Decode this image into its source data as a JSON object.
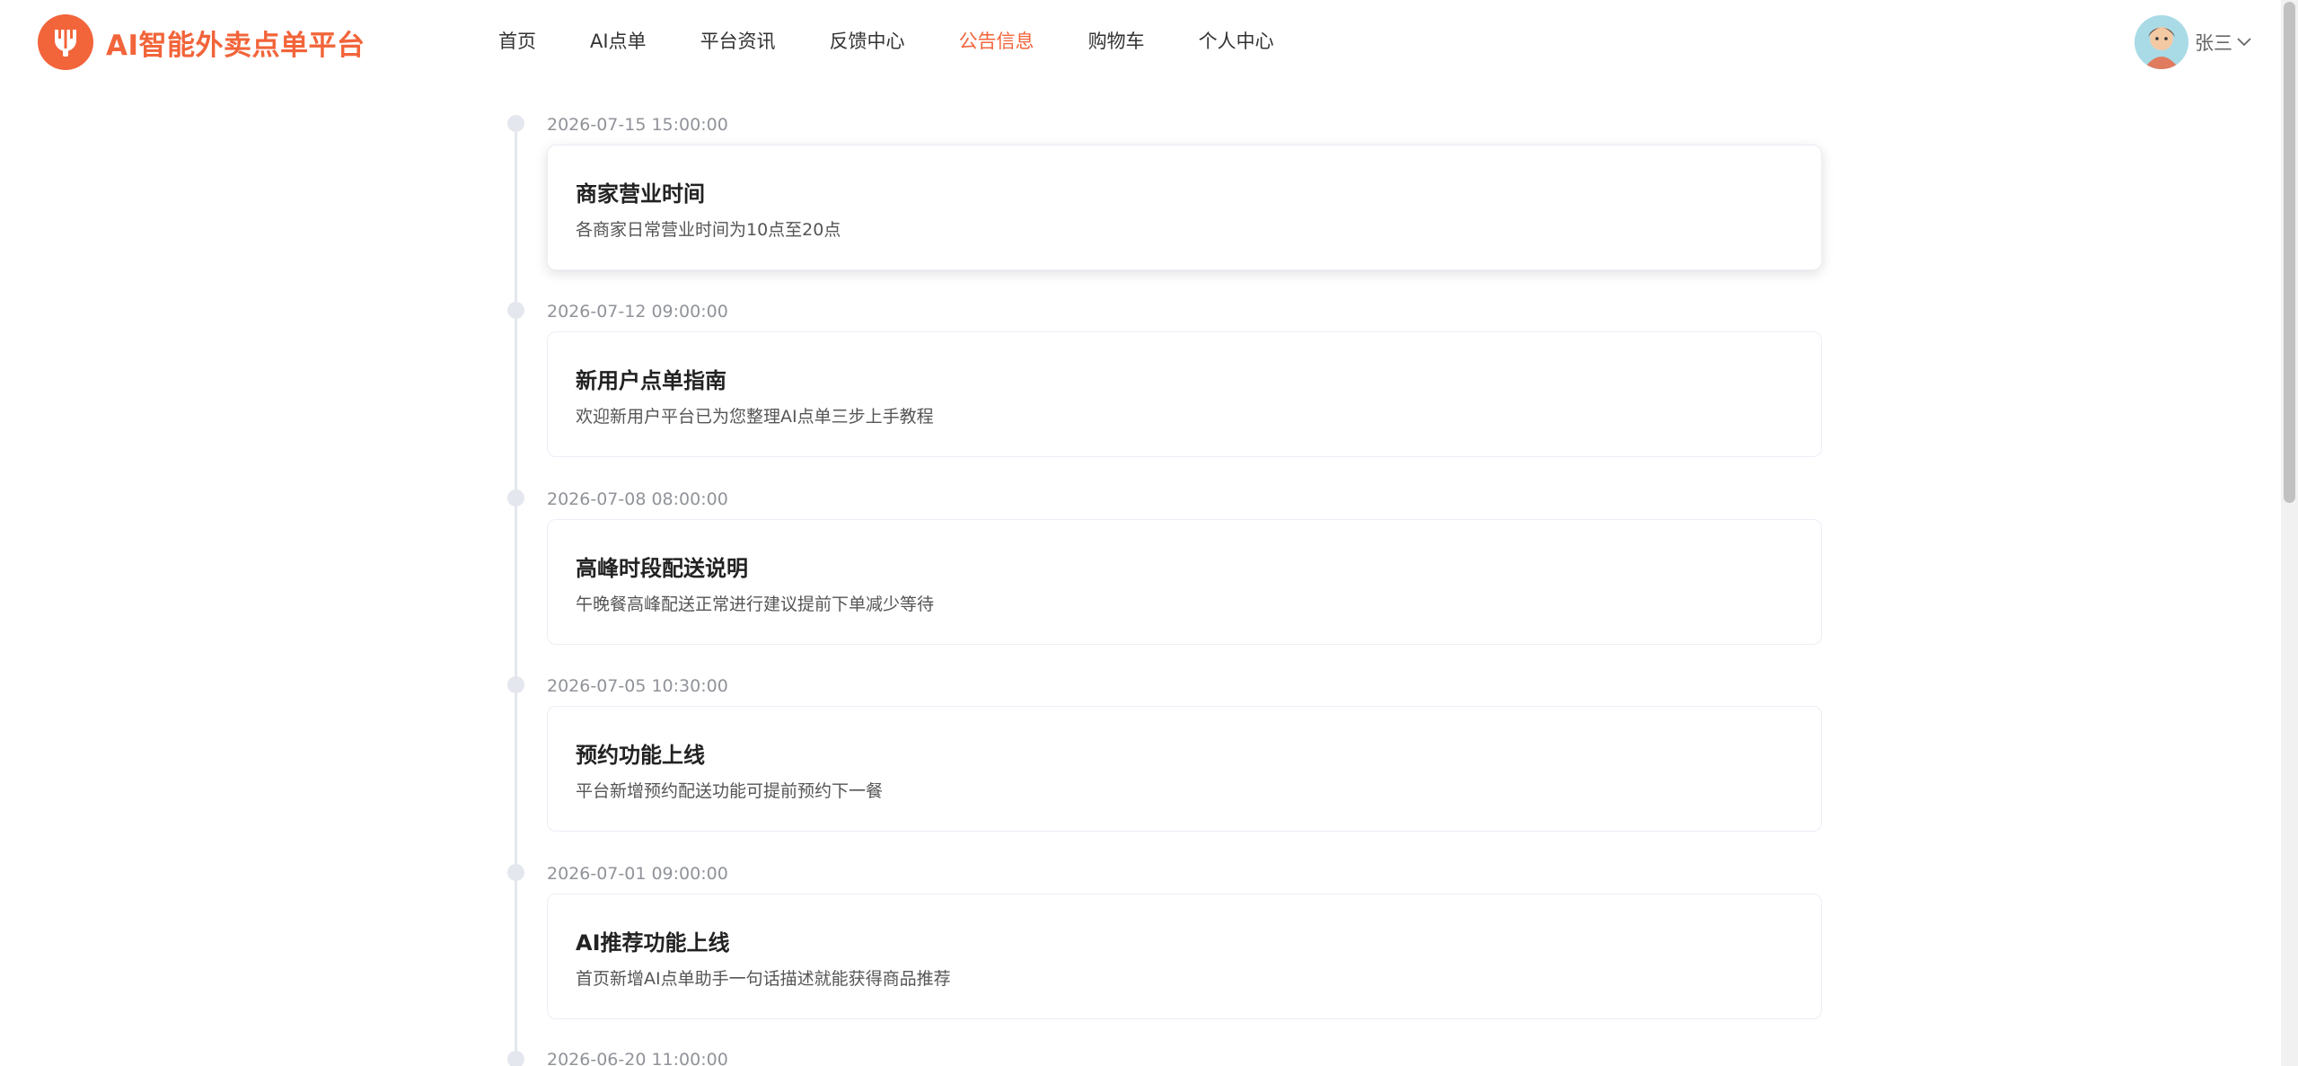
{
  "brand": {
    "name": "AI智能外卖点单平台",
    "color": "#f2643a",
    "icon": "fork-knife-icon"
  },
  "nav": {
    "items": [
      {
        "label": "首页",
        "active": false
      },
      {
        "label": "AI点单",
        "active": false
      },
      {
        "label": "平台资讯",
        "active": false
      },
      {
        "label": "反馈中心",
        "active": false
      },
      {
        "label": "公告信息",
        "active": true
      },
      {
        "label": "购物车",
        "active": false
      },
      {
        "label": "个人中心",
        "active": false
      }
    ]
  },
  "user": {
    "name": "张三",
    "dropdown_icon": "chevron-down-icon"
  },
  "announcements": [
    {
      "time": "2026-07-15 15:00:00",
      "title": "商家营业时间",
      "content": "各商家日常营业时间为10点至20点"
    },
    {
      "time": "2026-07-12 09:00:00",
      "title": "新用户点单指南",
      "content": "欢迎新用户平台已为您整理AI点单三步上手教程"
    },
    {
      "time": "2026-07-08 08:00:00",
      "title": "高峰时段配送说明",
      "content": "午晚餐高峰配送正常进行建议提前下单减少等待"
    },
    {
      "time": "2026-07-05 10:30:00",
      "title": "预约功能上线",
      "content": "平台新增预约配送功能可提前预约下一餐"
    },
    {
      "time": "2026-07-01 09:00:00",
      "title": "AI推荐功能上线",
      "content": "首页新增AI点单助手一句话描述就能获得商品推荐"
    },
    {
      "time": "2026-06-20 11:00:00",
      "title": "",
      "content": ""
    }
  ]
}
